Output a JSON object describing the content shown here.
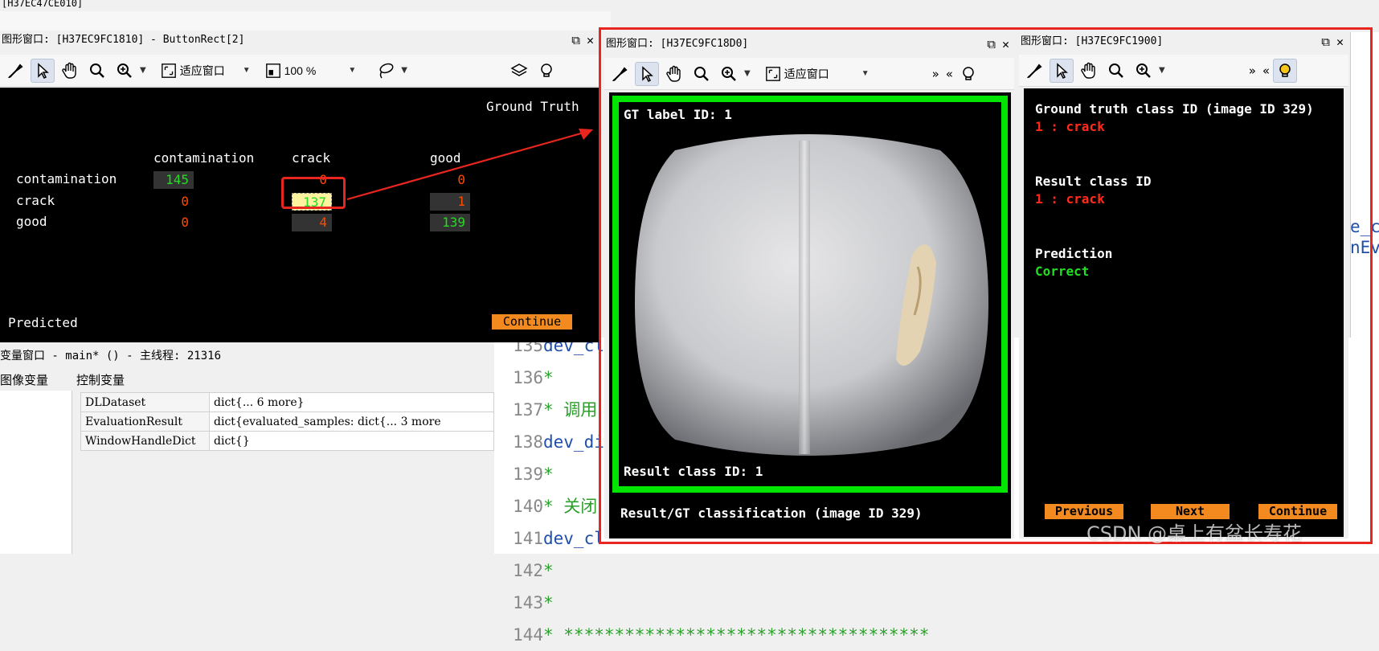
{
  "bg_window": {
    "title": "[H37EC47CE010]",
    "fit_label": "适应窗口",
    "zoom": "100 %"
  },
  "window1": {
    "title": "图形窗口: [H37EC9FC1810] - ButtonRect[2]",
    "fit_label": "适应窗口",
    "zoom": "100 %",
    "header_label": "Ground Truth",
    "predicted_label": "Predicted",
    "continue_label": "Continue",
    "columns": [
      "contamination",
      "crack",
      "good"
    ],
    "rows": [
      {
        "label": "contamination",
        "values": [
          "145",
          "0",
          "0"
        ]
      },
      {
        "label": "crack",
        "values": [
          "0",
          "137",
          "1"
        ]
      },
      {
        "label": "good",
        "values": [
          "0",
          "4",
          "139"
        ]
      }
    ]
  },
  "window2": {
    "title": "图形窗口: [H37EC9FC18D0]",
    "fit_label": "适应窗口",
    "gt_label": "GT label ID: 1",
    "result_label": "Result class ID: 1",
    "footer": "Result/GT classification (image ID 329)"
  },
  "window3": {
    "title": "图形窗口: [H37EC9FC1900]",
    "gt_heading": "Ground truth class ID (image ID 329)",
    "gt_value": "1 : crack",
    "result_heading": "Result class ID",
    "result_value": "1 : crack",
    "prediction_heading": "Prediction",
    "prediction_value": "Correct",
    "buttons": [
      "Previous",
      "Next",
      "Continue"
    ]
  },
  "variables": {
    "title": "变量窗口 - main* () - 主线程: 21316",
    "tab_image": "图像变量",
    "tab_control": "控制变量",
    "rows": [
      {
        "name": "DLDataset",
        "value": "dict{... 6 more}"
      },
      {
        "name": "EvaluationResult",
        "value": "dict{evaluated_samples: dict{... 3 more"
      },
      {
        "name": "WindowHandleDict",
        "value": "dict{}"
      }
    ]
  },
  "code": {
    "lines": [
      {
        "num": "135",
        "text": "dev_cl",
        "type": "code"
      },
      {
        "num": "136",
        "text": "*",
        "type": "comment"
      },
      {
        "num": "137",
        "text": "* 调用",
        "type": "comment"
      },
      {
        "num": "138",
        "text": "dev_di",
        "type": "code"
      },
      {
        "num": "139",
        "text": "*",
        "type": "comment"
      },
      {
        "num": "140",
        "text": "* 关闭",
        "type": "comment"
      },
      {
        "num": "141",
        "text": "dev_cl",
        "type": "code"
      },
      {
        "num": "142",
        "text": "*",
        "type": "comment"
      },
      {
        "num": "143",
        "text": "*",
        "type": "comment"
      },
      {
        "num": "144",
        "text": "* ************************************",
        "type": "comment"
      }
    ],
    "right_fragments": [
      "e_ch",
      "nEva"
    ]
  },
  "watermark": "CSDN @桌上有盆长寿花",
  "colors": {
    "highlight_red": "#e8261f",
    "green_frame": "#00e600",
    "orange_button": "#f28a1f",
    "cm_green": "#22dd22",
    "cm_orange": "#ff4b00"
  }
}
